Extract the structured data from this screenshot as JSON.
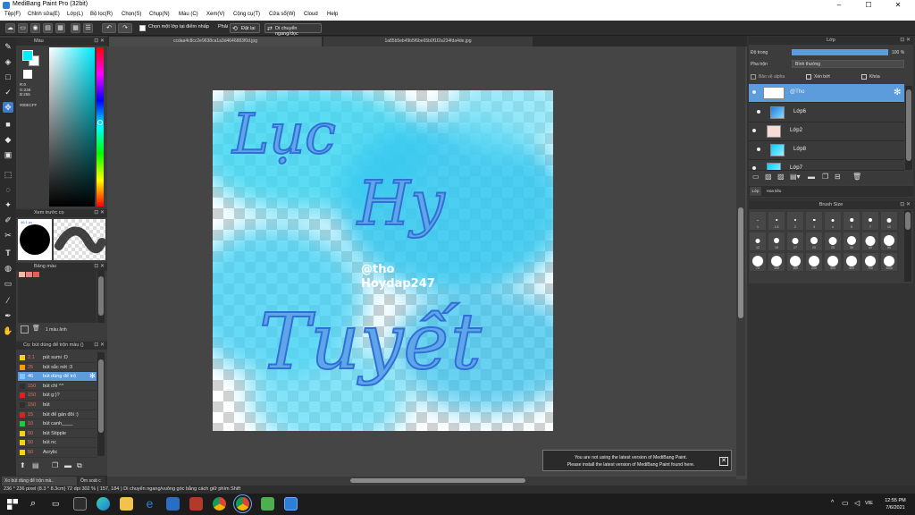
{
  "window": {
    "title": "MediBang Paint Pro (32bit)",
    "controls": [
      "–",
      "☐",
      "✕"
    ]
  },
  "menu": [
    "Tệp(F)",
    "Chỉnh sửa(E)",
    "Lớp(L)",
    "Bộ lọc(R)",
    "Chọn(S)",
    "Chụp(N)",
    "Màu (C)",
    "Xem(V)",
    "Cộng cụ(T)",
    "Cửa sổ(W)",
    "Cloud",
    "Help"
  ],
  "toolbar": {
    "snap_checkbox_label": "Chọn một lớp tại điểm nhấp",
    "mode_label": "Phải",
    "reset_label": "Đặt lại",
    "move_mode_label": "Di chuyển ngang/dọc"
  },
  "tabs": [
    {
      "label": "ccdaa4c8cc2e9638ca1a3d4646883f0d.jpg",
      "active": true
    },
    {
      "label": "1a85b5eb49b5f6be65b0f1f2a234fda4de.jpg",
      "active": false
    }
  ],
  "color_panel": {
    "title": "Màu",
    "r": "R:0",
    "g": "G:236",
    "b": "B:255",
    "hex": "#00ECFF",
    "fg_color": "#00ecff",
    "bg_color": "#ffffff"
  },
  "preview_panel": {
    "title": "Xem trước cọ",
    "size_label": "46.1 px"
  },
  "palette_panel": {
    "title": "Bảng màu",
    "swatches": [
      "#f2b8a8",
      "#f08080",
      "#ee5a5a"
    ],
    "footer_label": "1 màu ảnh"
  },
  "brush_panel": {
    "title": "Cọ: bút dùng để trộn màu ()",
    "items": [
      {
        "size": "2.1",
        "name": "pút sumi :D",
        "color": "#f2d21b",
        "selected": false
      },
      {
        "size": "25",
        "name": "bút sắc nét :3",
        "color": "#f0a000",
        "selected": false
      },
      {
        "size": "46",
        "name": "bút dùng để trộ",
        "color": "#7ec8ff",
        "selected": true
      },
      {
        "size": "150",
        "name": "bút chì ^^",
        "color": "#2f2f2f",
        "selected": false
      },
      {
        "size": "150",
        "name": "bút g:)?",
        "color": "#e02020",
        "selected": false
      },
      {
        "size": "150",
        "name": "bút",
        "color": "#2f2f2f",
        "selected": false
      },
      {
        "size": "15",
        "name": "bút để gán đôi :)",
        "color": "#e02020",
        "selected": false
      },
      {
        "size": "10",
        "name": "bút canh____",
        "color": "#22c83c",
        "selected": false
      },
      {
        "size": "50",
        "name": "bút Stipple",
        "color": "#f2d21b",
        "selected": false
      },
      {
        "size": "50",
        "name": "bút nc",
        "color": "#f2d21b",
        "selected": false
      },
      {
        "size": "50",
        "name": "Acrylic",
        "color": "#f2d21b",
        "selected": false
      }
    ],
    "bottom_tab_1": "Xo bút dùng để trộn mà..",
    "bottom_tab_2": "Ôm soát c"
  },
  "canvas_art": {
    "word1": "Lục",
    "word2": "Hy",
    "word3": "Tuyết",
    "stamp_line1": "@tho",
    "stamp_line2": "Hoydap247"
  },
  "notification": {
    "line1": "You are not using the latest version of MediBang Paint.",
    "line2": "Please install the latest version of MediBang Paint found here."
  },
  "statusbar": {
    "text": "236 * 236 pixel   (8.3 * 8.3cm)   72 dpi   302 %   ( 157, 184 )   Di chuyển ngang/vuông góc bằng cách giữ phím Shift"
  },
  "layer_panel": {
    "title": "Lớp",
    "opacity_label": "Độ trong",
    "opacity_value": "100 %",
    "opacity_fraction": 1.0,
    "blend_label": "Pha trộn",
    "blend_value": "Bình thường",
    "protect_alpha": "Bảo vệ alpha",
    "clipping": "Xén bớt",
    "lock": "Khóa",
    "layers": [
      {
        "name": "@Tho",
        "selected": true
      },
      {
        "name": "Lớp6",
        "selected": false
      },
      {
        "name": "Lớp2",
        "selected": false
      },
      {
        "name": "Lớp8",
        "selected": false
      },
      {
        "name": "Lớp7",
        "selected": false
      }
    ],
    "subtab_1": "Lớp",
    "subtab_2": "Hoa tiêu"
  },
  "brush_size_panel": {
    "title": "Brush Size",
    "row1": [
      "1",
      "1.5",
      "2",
      "3",
      "4",
      "5",
      "7",
      "10"
    ],
    "row2": [
      "12",
      "15",
      "17",
      "20",
      "25",
      "30",
      "40",
      "50"
    ],
    "row3": [
      "70",
      "100",
      "150",
      "200",
      "300",
      "400",
      "700",
      "1000"
    ]
  },
  "taskbar": {
    "lang": "VIE",
    "time": "12:55 PM",
    "date": "7/6/2021"
  }
}
